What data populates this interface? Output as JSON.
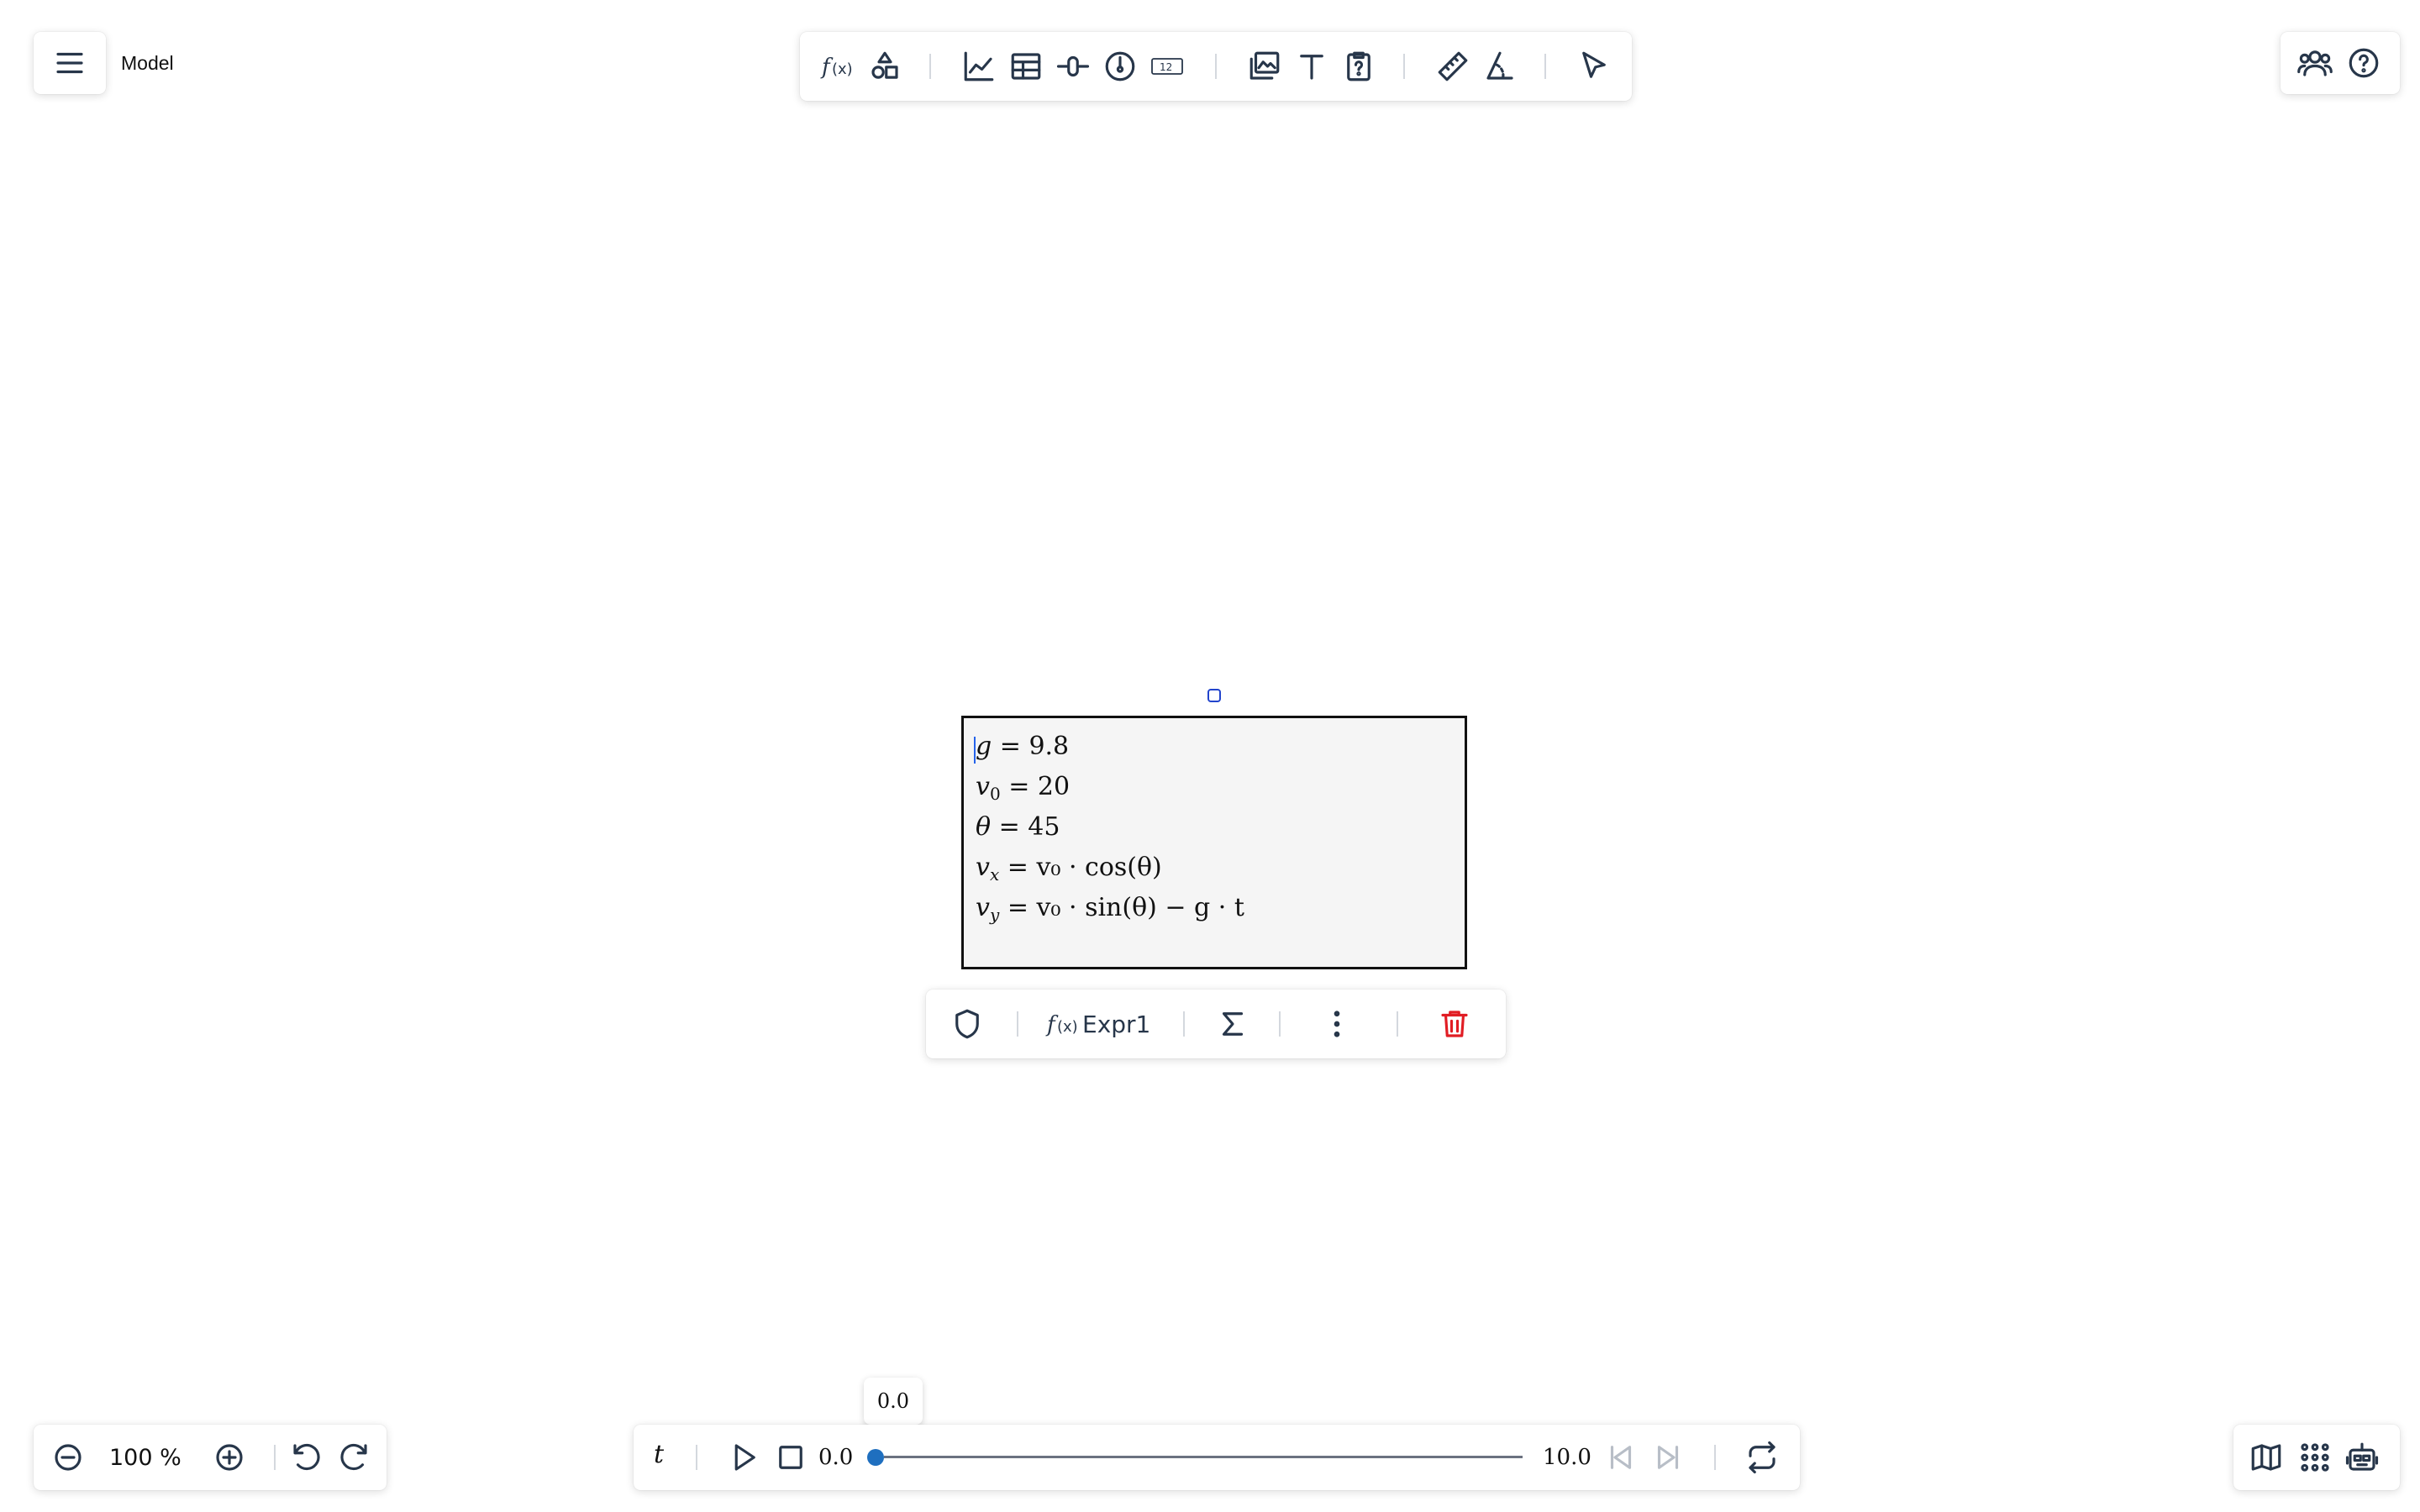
{
  "header": {
    "menu_icon": "hamburger-menu-icon",
    "title": "Model"
  },
  "toolbar": {
    "tools": [
      {
        "name": "function-tool",
        "icon": "fx-icon"
      },
      {
        "name": "shapes-tool",
        "icon": "shapes-icon"
      },
      {
        "name": "graph-tool",
        "icon": "line-chart-icon"
      },
      {
        "name": "table-tool",
        "icon": "table-icon"
      },
      {
        "name": "slider-tool",
        "icon": "slider-icon"
      },
      {
        "name": "gauge-tool",
        "icon": "gauge-icon"
      },
      {
        "name": "number-tool",
        "icon": "number-box-icon",
        "glyph": "12"
      },
      {
        "name": "media-tool",
        "icon": "media-icon"
      },
      {
        "name": "text-tool",
        "icon": "text-icon"
      },
      {
        "name": "question-tool",
        "icon": "question-card-icon"
      },
      {
        "name": "ruler-tool",
        "icon": "ruler-icon"
      },
      {
        "name": "protractor-tool",
        "icon": "protractor-icon"
      },
      {
        "name": "select-tool",
        "icon": "pointer-icon"
      }
    ]
  },
  "collab": {
    "collaborators_icon": "users-icon",
    "help_icon": "help-icon"
  },
  "expression": {
    "lines": [
      {
        "lhs": "g",
        "rhs": "= 9.8"
      },
      {
        "lhs": "v",
        "sub": "0",
        "rhs": "= 20"
      },
      {
        "lhs": "θ",
        "rhs": "= 45"
      },
      {
        "lhs": "v",
        "sub": "x",
        "rhs": "= v₀ · cos(θ)"
      },
      {
        "lhs": "v",
        "sub": "y",
        "rhs": "= v₀ · sin(θ) − g · t"
      }
    ]
  },
  "context_toolbar": {
    "shield_icon": "shield-icon",
    "expr_label": "Expr1",
    "sigma_icon": "sigma-icon",
    "more_icon": "more-vertical-icon",
    "delete_icon": "trash-icon"
  },
  "zoom": {
    "level": "100 %",
    "out_icon": "zoom-out-icon",
    "in_icon": "zoom-in-icon",
    "undo_icon": "undo-icon",
    "redo_icon": "redo-icon"
  },
  "timeline": {
    "variable": "t",
    "start": "0.0",
    "end": "10.0",
    "current": "0.0",
    "position_fraction": 0.0,
    "tooltip": "0.0"
  },
  "bottom_right": {
    "map_icon": "map-icon",
    "grid_icon": "grid-icon",
    "robot_icon": "robot-icon"
  },
  "colors": {
    "accent": "#1f6fbf",
    "delete": "#e11d24",
    "selection": "#2244cc"
  }
}
